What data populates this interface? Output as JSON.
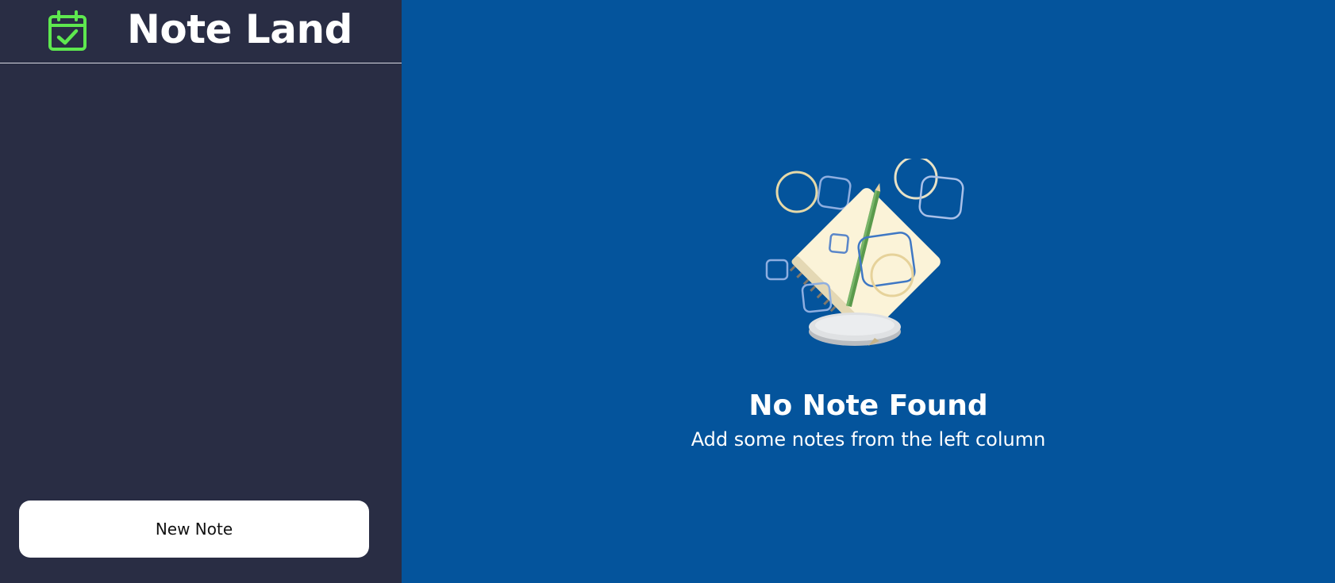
{
  "app": {
    "title": "Note Land",
    "logo_icon": "calendar-check-icon",
    "accent_color": "#5ee84f"
  },
  "sidebar": {
    "background": "#292d44",
    "new_note_label": "New Note",
    "notes": []
  },
  "main": {
    "background": "#04549c",
    "illustration_icon": "notebook-pencil-illustration",
    "empty_title": "No Note Found",
    "empty_subtitle": "Add some notes from the left column"
  }
}
